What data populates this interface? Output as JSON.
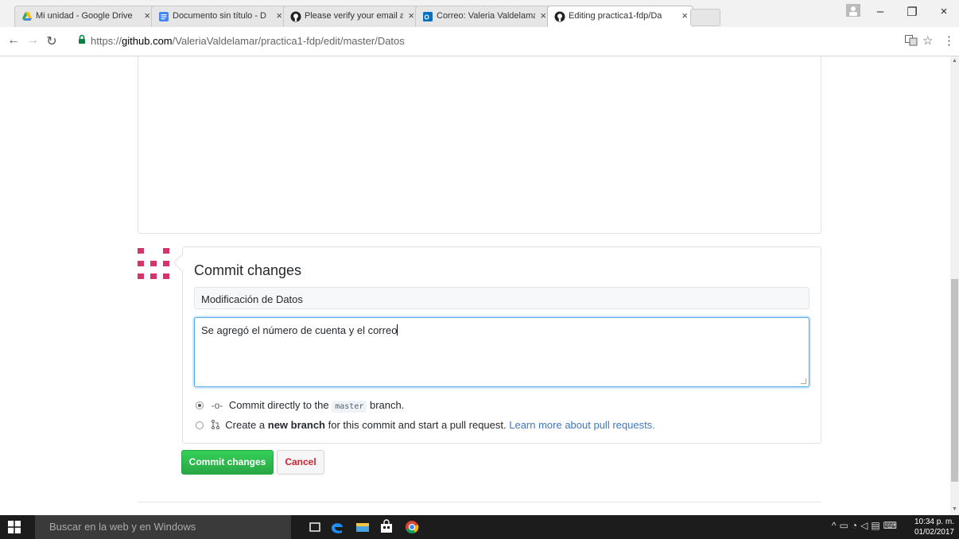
{
  "browser": {
    "tabs": [
      {
        "title": "Mi unidad - Google Drive",
        "icon": "google-drive-icon",
        "active": false
      },
      {
        "title": "Documento sin título - D",
        "icon": "google-docs-icon",
        "active": false
      },
      {
        "title": "Please verify your email a",
        "icon": "github-icon",
        "active": false
      },
      {
        "title": "Correo: Valeria Valdelama",
        "icon": "outlook-icon",
        "active": false
      },
      {
        "title": "Editing practica1-fdp/Da",
        "icon": "github-icon",
        "active": true
      }
    ],
    "tab_close_glyph": "×",
    "url_scheme": "https://",
    "url_host": "github.com",
    "url_path": "/ValeriaValdelamar/practica1-fdp/edit/master/Datos"
  },
  "commit": {
    "title": "Commit changes",
    "summary_value": "Modificación de Datos",
    "description_value": "Se agregó el número de cuenta y el correo",
    "option_direct_prefix": "Commit directly to the",
    "option_direct_branch": "master",
    "option_direct_suffix": "branch.",
    "option_new_prefix": "Create a",
    "option_new_bold": "new branch",
    "option_new_suffix": "for this commit and start a pull request.",
    "option_new_link": "Learn more about pull requests.",
    "submit_label": "Commit changes",
    "cancel_label": "Cancel"
  },
  "taskbar": {
    "search_placeholder": "Buscar en la web y en Windows",
    "time": "10:34 p. m.",
    "date": "01/02/2017"
  },
  "colors": {
    "commit_button": "#28a745",
    "cancel_text": "#cb2431",
    "link": "#4078c0",
    "avatar": "#d6336c"
  }
}
